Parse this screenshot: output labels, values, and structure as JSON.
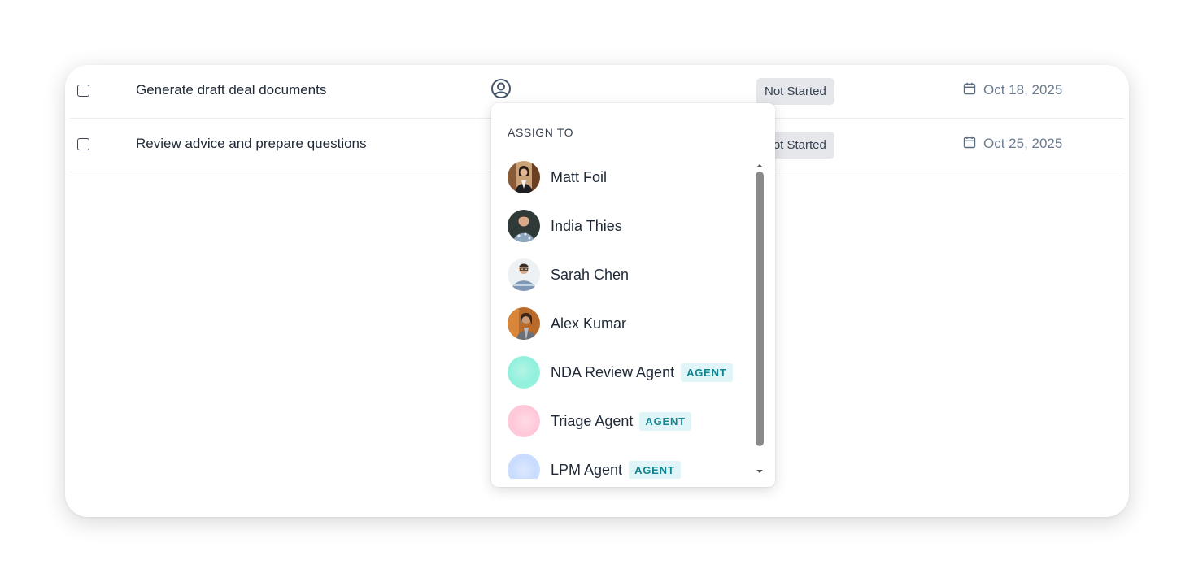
{
  "tasks": [
    {
      "title": "Generate draft deal documents",
      "status": "Not Started",
      "due": "Oct 18, 2025"
    },
    {
      "title": "Review advice and prepare questions",
      "status": "Not Started",
      "due": "Oct 25, 2025"
    }
  ],
  "assign_dropdown": {
    "header": "ASSIGN TO",
    "items": [
      {
        "name": "Matt Foil",
        "type": "person",
        "avatar": "photo"
      },
      {
        "name": "India Thies",
        "type": "person",
        "avatar": "photo"
      },
      {
        "name": "Sarah Chen",
        "type": "person",
        "avatar": "photo"
      },
      {
        "name": "Alex Kumar",
        "type": "person",
        "avatar": "photo"
      },
      {
        "name": "NDA Review Agent",
        "type": "agent",
        "badge": "AGENT",
        "avatar_color": "#8ff0dc"
      },
      {
        "name": "Triage Agent",
        "type": "agent",
        "badge": "AGENT",
        "avatar_color": "#ffc8d8"
      },
      {
        "name": "LPM Agent",
        "type": "agent",
        "badge": "AGENT",
        "avatar_color": "#c8dcff"
      }
    ]
  },
  "icons": {
    "assignee": "user-circle-icon",
    "due_date": "calendar-icon",
    "checkbox": "checkbox-empty"
  },
  "colors": {
    "status_badge_bg": "#e5e7eb",
    "agent_badge_bg": "#dff5f8",
    "agent_badge_text": "#13858f",
    "date_text": "#6b7b8f"
  }
}
